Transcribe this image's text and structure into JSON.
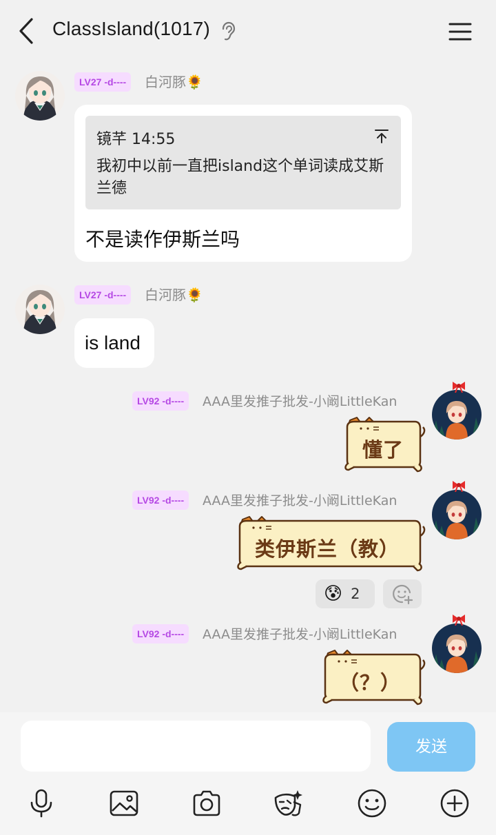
{
  "header": {
    "title": "ClassIsland(1017)"
  },
  "messages": [
    {
      "level": "LV27 -d----",
      "sender": "白河豚🌻",
      "quote": {
        "meta": "镜芊 14:55",
        "text": "我初中以前一直把island这个单词读成艾斯兰德"
      },
      "text": "不是读作伊斯兰吗"
    },
    {
      "level": "LV27 -d----",
      "sender": "白河豚🌻",
      "text": "is land"
    },
    {
      "level": "LV92 -d----",
      "sender": "AAA里发推子批发-小阚LittleKan",
      "text": "懂了"
    },
    {
      "level": "LV92 -d----",
      "sender": "AAA里发推子批发-小阚LittleKan",
      "text": "类伊斯兰（教）",
      "reaction": {
        "emoji": "😰",
        "count": "2"
      }
    },
    {
      "level": "LV92 -d----",
      "sender": "AAA里发推子批发-小阚LittleKan",
      "text": "（？）"
    }
  ],
  "composer": {
    "input_value": "",
    "send_label": "发送"
  },
  "toolbar": [
    "mic-icon",
    "image-icon",
    "camera-icon",
    "mask-icon",
    "emoji-icon",
    "plus-icon"
  ],
  "colors": {
    "badge_bg": "#f6dcff",
    "badge_text": "#b548e4",
    "send_button": "#7ec6f4",
    "cat_bubble": "#fbf0c4"
  }
}
